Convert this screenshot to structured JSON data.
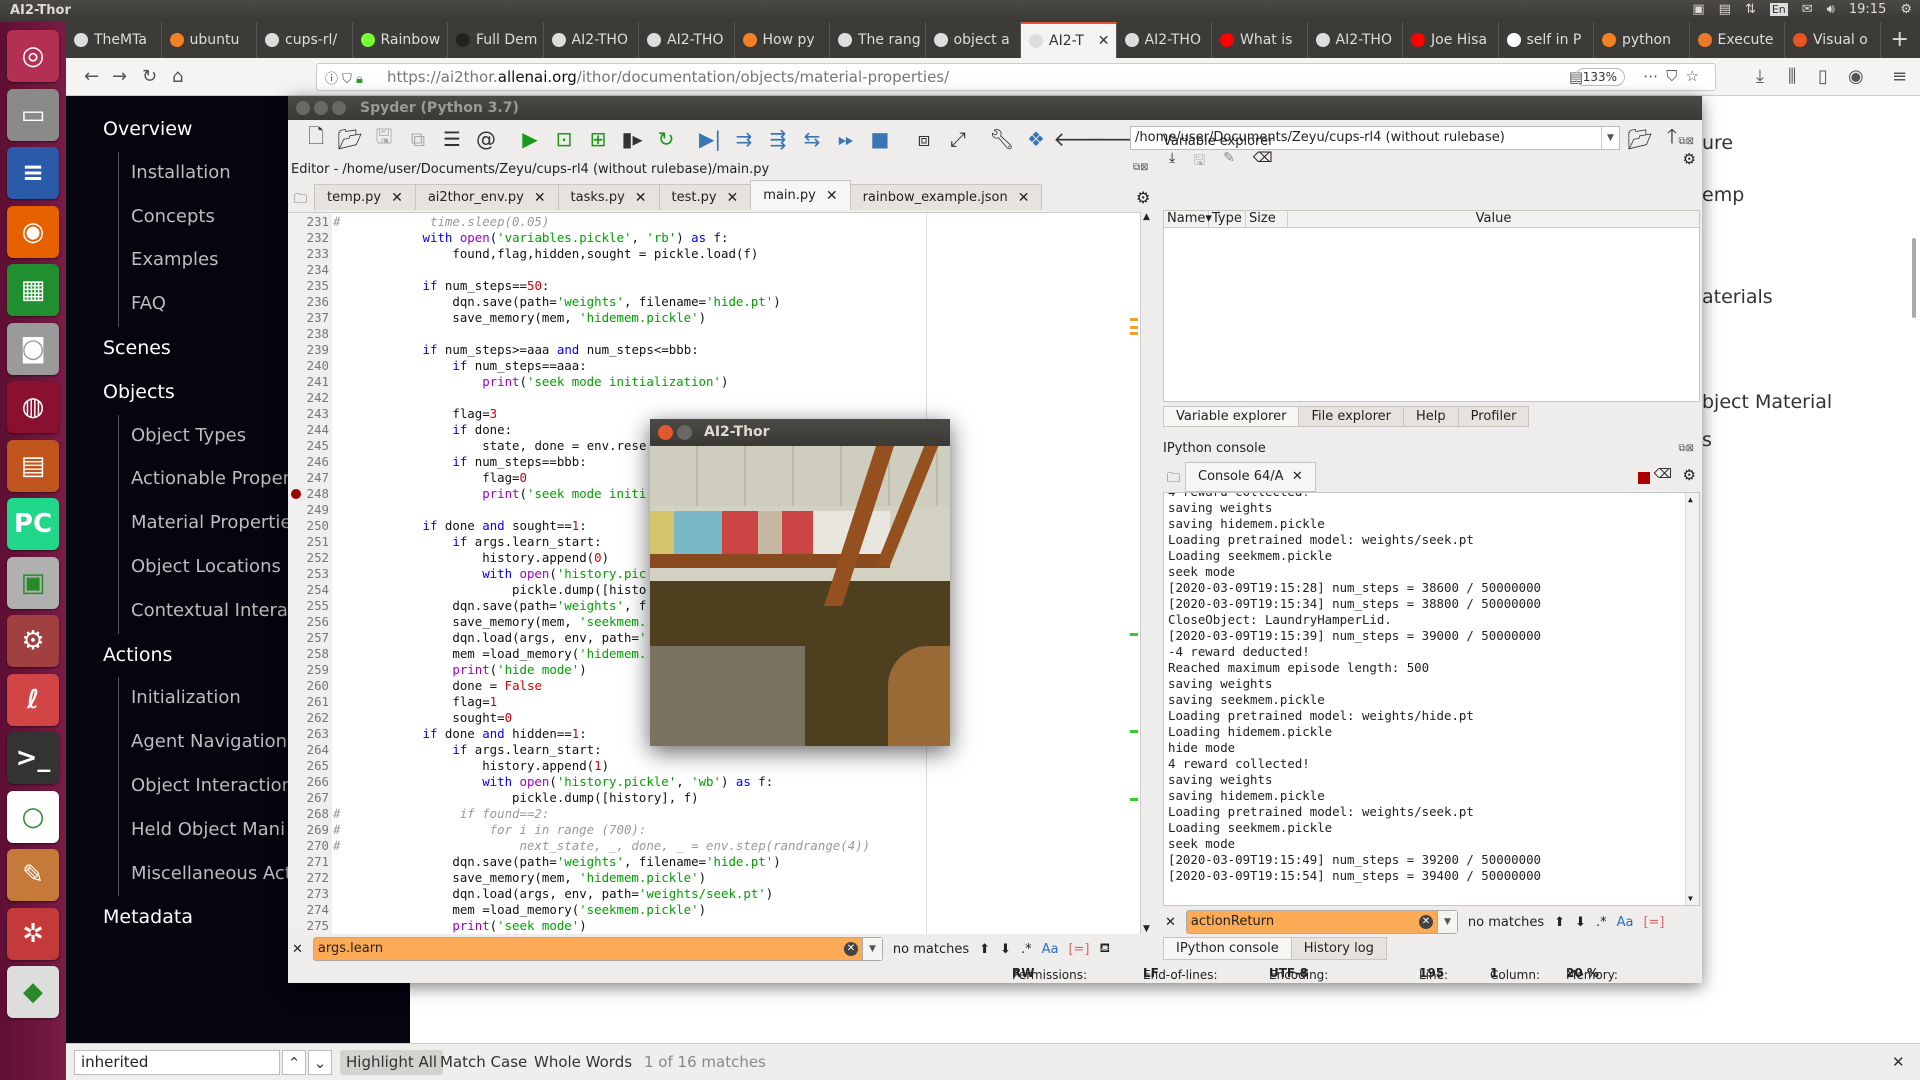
{
  "os": {
    "window_title": "AI2-Thor",
    "clock": "19:15",
    "keyboard": "En",
    "launcher": [
      {
        "name": "ubuntu-dash",
        "color": "#b43052",
        "glyph": "◎"
      },
      {
        "name": "files",
        "color": "#8a8a8a",
        "glyph": "▭"
      },
      {
        "name": "libreoffice-writer",
        "color": "#2a5aa8",
        "glyph": "≡"
      },
      {
        "name": "firefox",
        "color": "#e66000",
        "glyph": "◉"
      },
      {
        "name": "libreoffice-calc",
        "color": "#1f8f2f",
        "glyph": "▦"
      },
      {
        "name": "camera",
        "color": "#9a9a9a",
        "glyph": "◙"
      },
      {
        "name": "app-red",
        "color": "#8a1030",
        "glyph": "◍"
      },
      {
        "name": "libreoffice-impress",
        "color": "#c0561d",
        "glyph": "▤"
      },
      {
        "name": "pycharm",
        "color": "#21d789",
        "glyph": "PC"
      },
      {
        "name": "software-center",
        "color": "#b0b0b0",
        "glyph": "▣"
      },
      {
        "name": "system-settings",
        "color": "#a04040",
        "glyph": "⚙"
      },
      {
        "name": "document-viewer",
        "color": "#d24545",
        "glyph": "ℓ"
      },
      {
        "name": "terminal",
        "color": "#333333",
        "glyph": ">_"
      },
      {
        "name": "app-green",
        "color": "#ffffff",
        "glyph": "○"
      },
      {
        "name": "text-editor",
        "color": "#c57a3a",
        "glyph": "✎"
      },
      {
        "name": "app-web",
        "color": "#c43a3a",
        "glyph": "✲"
      },
      {
        "name": "unity",
        "color": "#dddddd",
        "glyph": "◆"
      }
    ]
  },
  "browser": {
    "tabs": [
      {
        "label": "TheMTa",
        "icon": "github"
      },
      {
        "label": "ubuntu",
        "icon": "stackoverflow"
      },
      {
        "label": "cups-rl/",
        "icon": "github"
      },
      {
        "label": "Rainbow",
        "icon": "smiley"
      },
      {
        "label": "Full Dem",
        "icon": "unity"
      },
      {
        "label": "AI2-THO",
        "icon": "ai2thor"
      },
      {
        "label": "AI2-THO",
        "icon": "ai2thor"
      },
      {
        "label": "How py",
        "icon": "stackoverflow"
      },
      {
        "label": "The rang",
        "icon": "github"
      },
      {
        "label": "object a",
        "icon": "github"
      },
      {
        "label": "AI2-T",
        "icon": "ai2thor",
        "active": true
      },
      {
        "label": "AI2-THO",
        "icon": "ai2thor"
      },
      {
        "label": "What is",
        "icon": "youtube"
      },
      {
        "label": "AI2-THO",
        "icon": "ai2thor"
      },
      {
        "label": "Joe Hisa",
        "icon": "youtube"
      },
      {
        "label": "self in P",
        "icon": "geeksforgeeks"
      },
      {
        "label": "python",
        "icon": "stackoverflow"
      },
      {
        "label": "Execute",
        "icon": "matlab"
      },
      {
        "label": "Visual o",
        "icon": "ubuntu"
      }
    ],
    "url_prefix": "https://ai2thor.",
    "url_domain": "allenai.org",
    "url_path": "/ithor/documentation/objects/material-properties/",
    "zoom": "133%",
    "find": {
      "value": "inherited",
      "highlight_all": "Highlight All",
      "match_case": "Match Case",
      "whole_words": "Whole Words",
      "result": "1 of 16 matches"
    }
  },
  "docs": {
    "sections": [
      {
        "label": "Overview",
        "items": [
          "Installation",
          "Concepts",
          "Examples",
          "FAQ"
        ]
      },
      {
        "label": "Scenes",
        "items": []
      },
      {
        "label": "Objects",
        "items": [
          "Object Types",
          "Actionable Proper",
          "Material Propertie",
          "Object Locations",
          "Contextual Intera"
        ]
      },
      {
        "label": "Actions",
        "items": [
          "Initialization",
          "Agent Navigation",
          "Object Interaction",
          "Held Object Mani",
          "Miscellaneous Act"
        ]
      },
      {
        "label": "Metadata",
        "items": []
      }
    ],
    "page_fragments": [
      "ure",
      "emp",
      "aterials",
      "bject Material",
      "s"
    ]
  },
  "spyder": {
    "title": "Spyder (Python 3.7)",
    "working_dir": "/home/user/Documents/Zeyu/cups-rl4 (without rulebase)",
    "editor_title": "Editor - /home/user/Documents/Zeyu/cups-rl4 (without rulebase)/main.py",
    "tabs": [
      "temp.py",
      "ai2thor_env.py",
      "tasks.py",
      "test.py",
      "main.py",
      "rainbow_example.json"
    ],
    "active_tab": "main.py",
    "breakpoint_line": 248,
    "code": [
      [
        231,
        "#            time.sleep(0.05)"
      ],
      [
        232,
        "            with open('variables.pickle', 'rb') as f:"
      ],
      [
        233,
        "                found,flag,hidden,sought = pickle.load(f)"
      ],
      [
        234,
        ""
      ],
      [
        235,
        "            if num_steps==50:"
      ],
      [
        236,
        "                dqn.save(path='weights', filename='hide.pt')"
      ],
      [
        237,
        "                save_memory(mem, 'hidemem.pickle')"
      ],
      [
        238,
        ""
      ],
      [
        239,
        "            if num_steps>=aaa and num_steps<=bbb:"
      ],
      [
        240,
        "                if num_steps==aaa:"
      ],
      [
        241,
        "                    print('seek mode initialization')"
      ],
      [
        242,
        ""
      ],
      [
        243,
        "                flag=3"
      ],
      [
        244,
        "                if done:"
      ],
      [
        245,
        "                    state, done = env.rese"
      ],
      [
        246,
        "                if num_steps==bbb:"
      ],
      [
        247,
        "                    flag=0"
      ],
      [
        248,
        "                    print('seek mode initi"
      ],
      [
        249,
        ""
      ],
      [
        250,
        "            if done and sought==1:"
      ],
      [
        251,
        "                if args.learn_start:"
      ],
      [
        252,
        "                    history.append(0)"
      ],
      [
        253,
        "                    with open('history.pic"
      ],
      [
        254,
        "                        pickle.dump([histo"
      ],
      [
        255,
        "                dqn.save(path='weights', f"
      ],
      [
        256,
        "                save_memory(mem, 'seekmem."
      ],
      [
        257,
        "                dqn.load(args, env, path='"
      ],
      [
        258,
        "                mem =load_memory('hidemem."
      ],
      [
        259,
        "                print('hide mode')"
      ],
      [
        260,
        "                done = False"
      ],
      [
        261,
        "                flag=1"
      ],
      [
        262,
        "                sought=0"
      ],
      [
        263,
        "            if done and hidden==1:"
      ],
      [
        264,
        "                if args.learn_start:"
      ],
      [
        265,
        "                    history.append(1)"
      ],
      [
        266,
        "                    with open('history.pickle', 'wb') as f:"
      ],
      [
        267,
        "                        pickle.dump([history], f)"
      ],
      [
        268,
        "#                if found==2:"
      ],
      [
        269,
        "#                    for i in range (700):"
      ],
      [
        270,
        "#                        next_state, _, done, _ = env.step(randrange(4))"
      ],
      [
        271,
        "                dqn.save(path='weights', filename='hide.pt')"
      ],
      [
        272,
        "                save_memory(mem, 'hidemem.pickle')"
      ],
      [
        273,
        "                dqn.load(args, env, path='weights/seek.pt')"
      ],
      [
        274,
        "                mem =load_memory('seekmem.pickle')"
      ],
      [
        275,
        "                print('seek mode')"
      ]
    ],
    "editor_find": {
      "value": "args.learn",
      "status": "no matches"
    },
    "variable_explorer": {
      "title": "Variable explorer",
      "columns": [
        "Name",
        "Type",
        "Size",
        "Value"
      ]
    },
    "pane_tabs": [
      "Variable explorer",
      "File explorer",
      "Help",
      "Profiler"
    ],
    "console": {
      "title": "IPython console",
      "tab": "Console 64/A",
      "lines": [
        "4 reward collected!",
        "saving weights",
        "saving hidemem.pickle",
        "Loading pretrained model: weights/seek.pt",
        "Loading seekmem.pickle",
        "seek mode",
        "[2020-03-09T19:15:28] num_steps = 38600 / 50000000",
        "[2020-03-09T19:15:34] num_steps = 38800 / 50000000",
        "CloseObject: LaundryHamperLid.",
        "[2020-03-09T19:15:39] num_steps = 39000 / 50000000",
        "-4 reward deducted!",
        "Reached maximum episode length: 500",
        "saving weights",
        "saving seekmem.pickle",
        "Loading pretrained model: weights/hide.pt",
        "Loading hidemem.pickle",
        "hide mode",
        "4 reward collected!",
        "saving weights",
        "saving hidemem.pickle",
        "Loading pretrained model: weights/seek.pt",
        "Loading seekmem.pickle",
        "seek mode",
        "[2020-03-09T19:15:49] num_steps = 39200 / 50000000",
        "[2020-03-09T19:15:54] num_steps = 39400 / 50000000"
      ],
      "find": {
        "value": "actionReturn",
        "status": "no matches"
      },
      "bottom_tabs": [
        "IPython console",
        "History log"
      ]
    },
    "status": {
      "permissions_label": "Permissions:",
      "permissions": "RW",
      "eol_label": "End-of-lines:",
      "eol": "LF",
      "encoding_label": "Encoding:",
      "encoding": "UTF-8",
      "line_label": "Line:",
      "line": "195",
      "column_label": "Column:",
      "column": "1",
      "memory_label": "Memory:",
      "memory": "20 %"
    }
  },
  "popup": {
    "title": "AI2-Thor"
  },
  "colors": {
    "find_highlight": "#fcaa55",
    "keyword": "#0000ff",
    "string": "#00a000",
    "builtin": "#9a00c8",
    "number": "#cc0000",
    "breakpoint": "#990000"
  }
}
